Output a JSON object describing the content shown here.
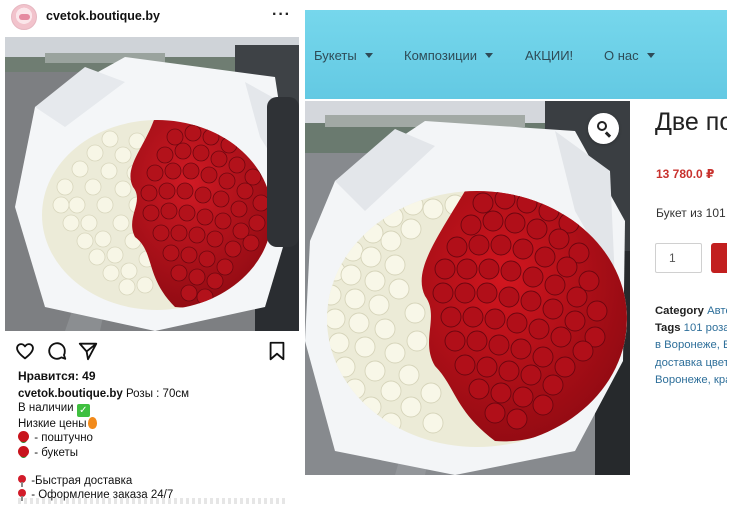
{
  "instagram": {
    "username": "cvetok.boutique.by",
    "more": "···",
    "likes": "Нравится: 49",
    "caption_user": "cvetok.boutique.by",
    "caption_text": " Розы : 70см",
    "lines": {
      "in_stock": "В наличии",
      "low_prices": "Низкие цены",
      "per_piece": " - поштучно",
      "bouquets": " - букеты",
      "delivery": " -Быстрая доставка",
      "order": " - Оформление заказа 24/7"
    },
    "icons": [
      "heart-icon",
      "comment-icon",
      "share-icon",
      "bookmark-icon"
    ]
  },
  "shop": {
    "nav": [
      {
        "label": "Букеты",
        "has_dropdown": true
      },
      {
        "label": "Композиции",
        "has_dropdown": true
      },
      {
        "label": "АКЦИИ!",
        "has_dropdown": false
      },
      {
        "label": "О нас",
        "has_dropdown": true
      }
    ],
    "nav_color": "#6fd3ea",
    "product_title": "Две по",
    "price": "13 780.0 ₽",
    "description": "Букет из 101",
    "quantity": "1",
    "category_label": "Category",
    "category_value": " Авто",
    "tags_label": "Tags",
    "tags_lines": [
      " 101 роза",
      "в Воронеже, Е",
      "доставка цвет",
      "Воронеже, кра"
    ]
  },
  "colors": {
    "price": "#c8312d",
    "cart_button": "#c21f1f",
    "link": "#2e6f9a"
  }
}
